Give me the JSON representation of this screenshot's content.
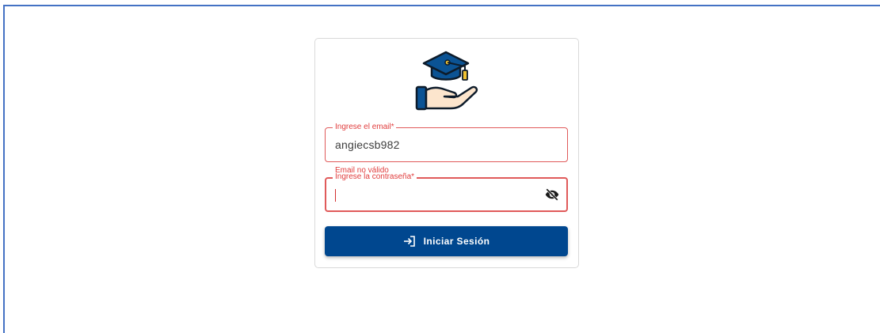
{
  "login": {
    "logo_icon": "graduation-cap-hand-icon",
    "email_field": {
      "label": "Ingrese el email*",
      "value": "angiecsb982",
      "error": "Email no válido"
    },
    "password_field": {
      "label": "Ingrese la contraseña*",
      "value": "",
      "toggle_icon": "eye-off-icon"
    },
    "submit": {
      "label": "Iniciar Sesión",
      "icon": "login-icon"
    }
  },
  "colors": {
    "primary": "#00478f",
    "error": "#e03c3c",
    "frame_border": "#4472c4"
  }
}
